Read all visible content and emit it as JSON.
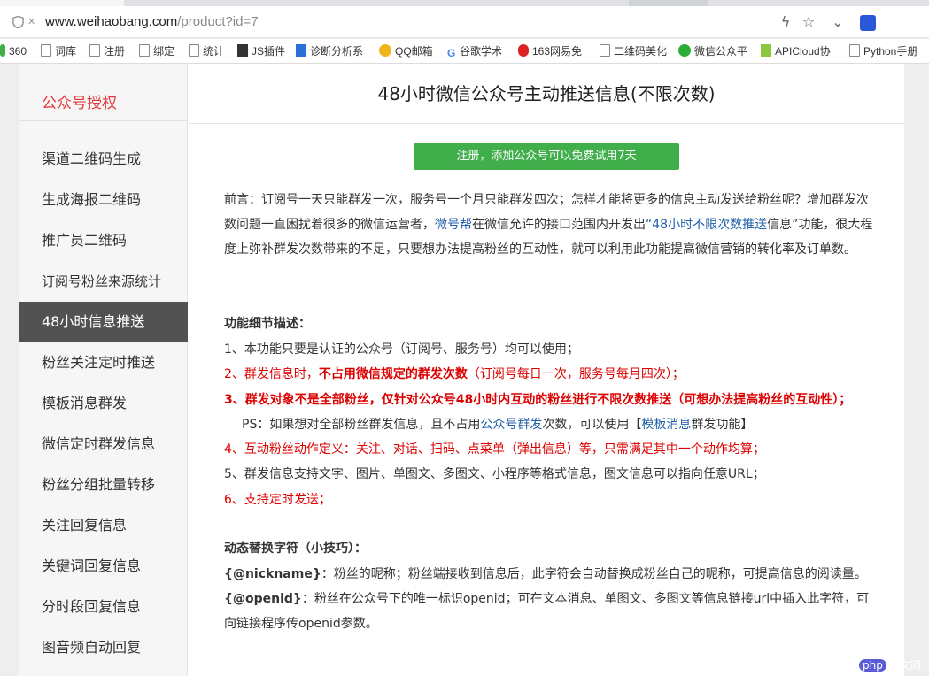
{
  "browser": {
    "url_host": "www.weihaobang.com",
    "url_path": "/product?id=7",
    "icons": [
      "shield-icon",
      "lightning-icon",
      "star-icon",
      "chevron-down-icon",
      "paw-icon"
    ]
  },
  "bookmarks": [
    {
      "label": "360",
      "icon": "dot-icon"
    },
    {
      "label": "词库",
      "icon": "doc-icon"
    },
    {
      "label": "注册",
      "icon": "doc-icon"
    },
    {
      "label": "绑定",
      "icon": "doc-icon"
    },
    {
      "label": "统计",
      "icon": "doc-icon"
    },
    {
      "label": "JS插件",
      "icon": "js-icon"
    },
    {
      "label": "诊断分析系",
      "icon": "diag-icon"
    },
    {
      "label": "QQ邮箱",
      "icon": "qq-icon"
    },
    {
      "label": "谷歌学术",
      "icon": "google-icon"
    },
    {
      "label": "163网易免",
      "icon": "163-icon"
    },
    {
      "label": "二维码美化",
      "icon": "doc-icon"
    },
    {
      "label": "微信公众平",
      "icon": "wechat-icon"
    },
    {
      "label": "APICloud协",
      "icon": "api-icon"
    },
    {
      "label": "Python手册",
      "icon": "doc-icon"
    }
  ],
  "sidebar": {
    "title": "公众号授权",
    "items": [
      {
        "label": "渠道二维码生成"
      },
      {
        "label": "生成海报二维码"
      },
      {
        "label": "推广员二维码"
      },
      {
        "label": "订阅号粉丝来源统计"
      },
      {
        "label": "48小时信息推送"
      },
      {
        "label": "粉丝关注定时推送"
      },
      {
        "label": "模板消息群发"
      },
      {
        "label": "微信定时群发信息"
      },
      {
        "label": "粉丝分组批量转移"
      },
      {
        "label": "关注回复信息"
      },
      {
        "label": "关键词回复信息"
      },
      {
        "label": "分时段回复信息"
      },
      {
        "label": "图音频自动回复"
      }
    ]
  },
  "main": {
    "title": "48小时微信公众号主动推送信息(不限次数)",
    "cta_label": "注册，添加公众号可以免费试用7天",
    "intro_prefix": "前言：订阅号一天只能群发一次，服务号一个月只能群发四次；怎样才能将更多的信息主动发送给粉丝呢？增加群发次数问题一直困扰着很多的微信运营者，",
    "intro_link1": "微号帮",
    "intro_mid": "在微信允许的接口范围内开发出",
    "intro_link2": "“48小时不限次数推送",
    "intro_suffix": "信息”功能，很大程度上弥补群发次数带来的不足，只要想办法提高粉丝的互动性，就可以利用此功能提高微信营销的转化率及订单数。",
    "features_heading": "功能细节描述：",
    "feature1": "1、本功能只要是认证的公众号（订阅号、服务号）均可以使用；",
    "feature2a": "2、群发信息时，",
    "feature2b": "不占用微信规定的群发次数",
    "feature2c": "（订阅号每日一次，服务号每月四次）；",
    "feature3": "3、群发对象不是全部粉丝，仅针对公众号48小时内互动的粉丝进行不限次数推送（可想办法提高粉丝的互动性）；",
    "ps_a": "PS：如果想对全部粉丝群发信息，且不占用",
    "ps_link1": "公众号群发",
    "ps_b": "次数，可以使用【",
    "ps_link2": "模板消息",
    "ps_c": "群发功能】",
    "feature4": "4、互动粉丝动作定义：关注、对话、扫码、点菜单（弹出信息）等，只需满足其中一个动作均算；",
    "feature5": "5、群发信息支持文字、图片、单图文、多图文、小程序等格式信息，图文信息可以指向任意URL；",
    "feature6": "6、支持定时发送；",
    "dynamic_heading": "动态替换字符（小技巧）：",
    "nick_token": "{@nickname}",
    "nick_desc": "：粉丝的昵称；粉丝端接收到信息后，此字符会自动替换成粉丝自己的昵称，可提高信息的阅读量。",
    "openid_token": "{@openid}",
    "openid_desc": "：粉丝在公众号下的唯一标识openid；可在文本消息、单图文、多图文等信息链接url中插入此字符，可向链接程序传openid参数。"
  },
  "watermark": {
    "badge": "php",
    "text": "中文网"
  },
  "colors": {
    "accent_red": "#e4393c",
    "active_bg": "#525252",
    "cta_green": "#3fae4b",
    "link_blue": "#1f5fa8"
  }
}
